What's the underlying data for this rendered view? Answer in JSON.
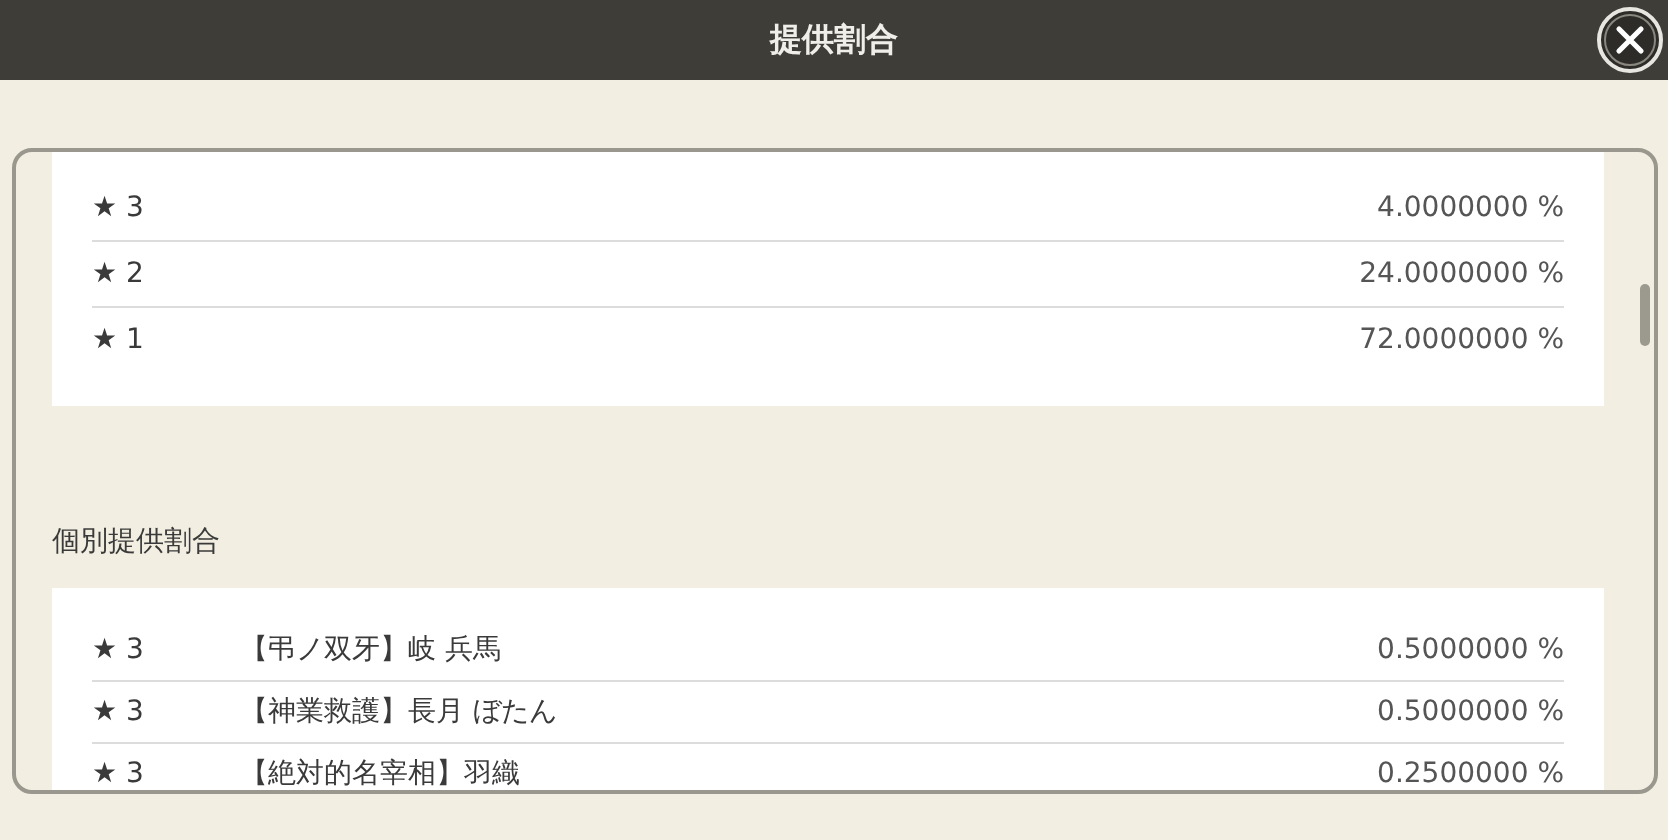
{
  "window": {
    "title": "提供割合"
  },
  "rarity_rates": [
    {
      "rarity": "★ 3",
      "rate": "4.0000000 %"
    },
    {
      "rarity": "★ 2",
      "rate": "24.0000000 %"
    },
    {
      "rarity": "★ 1",
      "rate": "72.0000000 %"
    }
  ],
  "individual_section": {
    "title": "個別提供割合",
    "rows": [
      {
        "rarity": "★ 3",
        "name": "【弔ノ双牙】岐 兵馬",
        "rate": "0.5000000 %"
      },
      {
        "rarity": "★ 3",
        "name": "【神業救護】長月 ぼたん",
        "rate": "0.5000000 %"
      },
      {
        "rarity": "★ 3",
        "name": "【絶対的名宰相】羽織",
        "rate": "0.2500000 %"
      }
    ]
  }
}
